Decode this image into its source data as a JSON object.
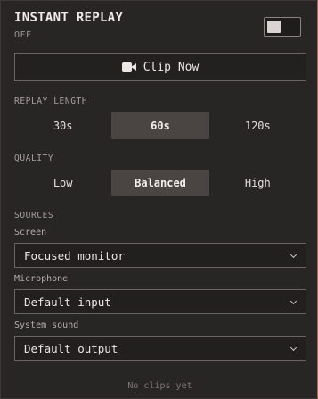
{
  "header": {
    "title": "INSTANT REPLAY",
    "status": "OFF",
    "toggle_on": false
  },
  "clip_button": {
    "label": "Clip Now",
    "icon": "video-camera-icon"
  },
  "replay_length": {
    "label": "REPLAY LENGTH",
    "options": [
      "30s",
      "60s",
      "120s"
    ],
    "selected": "60s"
  },
  "quality": {
    "label": "QUALITY",
    "options": [
      "Low",
      "Balanced",
      "High"
    ],
    "selected": "Balanced"
  },
  "sources": {
    "label": "SOURCES",
    "screen": {
      "label": "Screen",
      "value": "Focused monitor"
    },
    "microphone": {
      "label": "Microphone",
      "value": "Default input"
    },
    "system_sound": {
      "label": "System sound",
      "value": "Default output"
    }
  },
  "empty_state": "No clips yet",
  "colors": {
    "background": "#282525",
    "accent_border": "#c0634a",
    "active_segment": "#4a4442"
  }
}
